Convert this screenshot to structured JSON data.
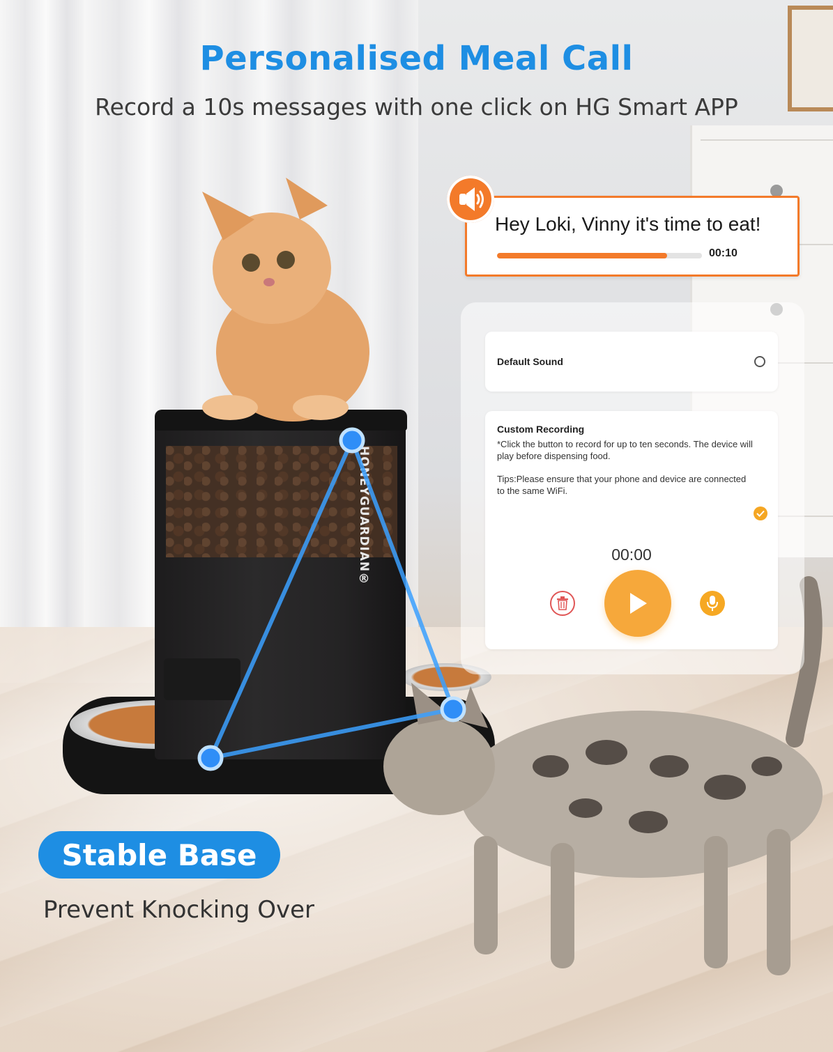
{
  "header": {
    "title": "Personalised Meal Call",
    "subtitle": "Record a 10s messages with one click on HG Smart APP"
  },
  "voice_message": {
    "text": "Hey Loki, Vinny it's time to eat!",
    "progress_fraction": 0.83,
    "time": "00:10",
    "icon": "speaker-icon"
  },
  "app": {
    "default_sound": {
      "label": "Default Sound",
      "selected": false
    },
    "custom_recording": {
      "label": "Custom Recording",
      "description": "*Click the button to record for up to ten seconds. The device will play before dispensing food.",
      "tips": "Tips:Please ensure that your phone and device are connected to the same WiFi.",
      "selected": true,
      "time": "00:00",
      "buttons": [
        "trash-icon",
        "play-icon",
        "mic-icon"
      ]
    }
  },
  "product": {
    "brand": "HONEYGUARDIAN®"
  },
  "feature": {
    "badge": "Stable Base",
    "subtitle": "Prevent Knocking Over"
  },
  "colors": {
    "accent_blue": "#1e8ee3",
    "accent_orange": "#f37a2a",
    "play_orange": "#f6a83b"
  }
}
